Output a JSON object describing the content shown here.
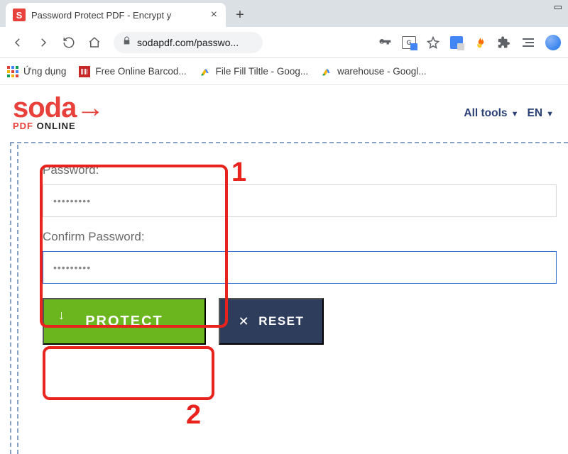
{
  "browser": {
    "tab": {
      "favicon_letter": "S",
      "title": "Password Protect PDF - Encrypt y"
    },
    "url": "sodapdf.com/passwo...",
    "bookmarks": [
      {
        "label": "Ứng dụng"
      },
      {
        "label": "Free Online Barcod..."
      },
      {
        "label": "File Fill Tiltle - Goog..."
      },
      {
        "label": "warehouse - Googl..."
      }
    ]
  },
  "site": {
    "logo": {
      "word": "soda",
      "arrow": "→",
      "sub_pdf": "PDF",
      "sub_online": " ONLINE"
    },
    "nav": {
      "all_tools": "All tools",
      "lang": "EN"
    }
  },
  "form": {
    "password_label": "Password:",
    "password_value": "•••••••••",
    "confirm_label": "Confirm Password:",
    "confirm_value": "•••••••••",
    "protect_button": "PROTECT",
    "reset_button": "RESET"
  },
  "annotations": {
    "step1": "1",
    "step2": "2"
  }
}
